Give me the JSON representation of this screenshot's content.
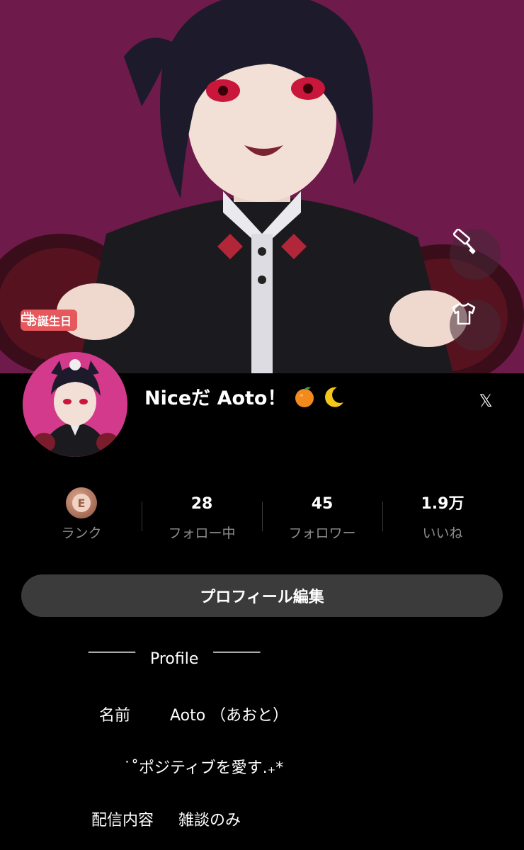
{
  "header": {
    "birthday_badge": "お誕生日",
    "icons": [
      "cake-icon",
      "paint-roller-icon",
      "shirt-icon"
    ]
  },
  "profile": {
    "name": "Niceだ Aoto！",
    "name_emojis": [
      "orange-emoji",
      "crescent-moon-emoji"
    ],
    "x_link": "𝕏"
  },
  "stats": [
    {
      "value": "E",
      "label": "ランク"
    },
    {
      "value": "28",
      "label": "フォロー中"
    },
    {
      "value": "45",
      "label": "フォロワー"
    },
    {
      "value": "1.9万",
      "label": "いいね"
    }
  ],
  "edit_button": "プロフィール編集",
  "bio": [
    "‾‾‾‾‾‾   Profile   ‾‾‾‾‾‾",
    "名前        Aoto （あおと）",
    "˙˚ポジティブを愛す.₊*",
    "配信内容     雑談のみ"
  ],
  "colors": {
    "background": "#000000",
    "cover": "#6e1a4b",
    "birthday_badge": "#e5585c",
    "edit_button": "#3b3b3b",
    "muted_text": "#8b8b8b"
  }
}
